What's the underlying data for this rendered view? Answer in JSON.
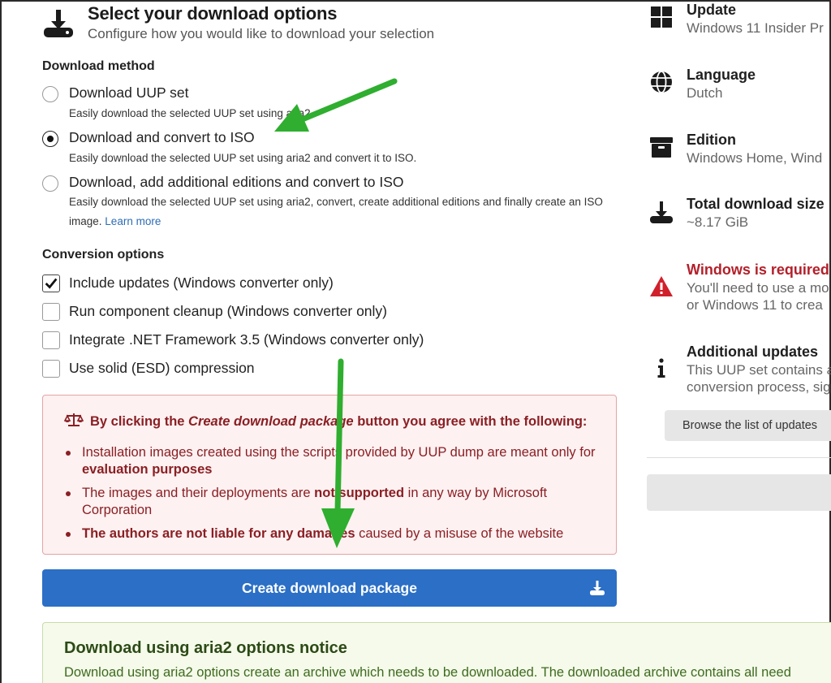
{
  "header": {
    "title": "Select your download options",
    "subtitle": "Configure how you would like to download your selection"
  },
  "download_method": {
    "label": "Download method",
    "options": [
      {
        "label": "Download UUP set",
        "desc": "Easily download the selected UUP set using aria2.",
        "checked": false
      },
      {
        "label": "Download and convert to ISO",
        "desc": "Easily download the selected UUP set using aria2 and convert it to ISO.",
        "checked": true
      },
      {
        "label": "Download, add additional editions and convert to ISO",
        "desc": "Easily download the selected UUP set using aria2, convert, create additional editions and finally create an ISO image.",
        "link": "Learn more",
        "checked": false
      }
    ]
  },
  "conversion": {
    "label": "Conversion options",
    "options": [
      {
        "label": "Include updates (Windows converter only)",
        "checked": true
      },
      {
        "label": "Run component cleanup (Windows converter only)",
        "checked": false
      },
      {
        "label": "Integrate .NET Framework 3.5 (Windows converter only)",
        "checked": false
      },
      {
        "label": "Use solid (ESD) compression",
        "checked": false
      }
    ]
  },
  "agreement": {
    "head_pre": "By clicking the ",
    "head_em": "Create download package",
    "head_post": " button you agree with the following:",
    "items": [
      {
        "pre": "Installation images created using the scripts provided by UUP dump are meant only for ",
        "bold": "evaluation purposes",
        "post": ""
      },
      {
        "pre": "The images and their deployments are ",
        "bold": "not supported",
        "post": " in any way by Microsoft Corporation"
      },
      {
        "pre": "",
        "bold": "The authors are not liable for any damages",
        "post": " caused by a misuse of the website"
      }
    ]
  },
  "create_button": "Create download package",
  "aria_notice": {
    "title": "Download using aria2 options notice",
    "text": "Download using aria2 options create an archive which needs to be downloaded. The downloaded archive contains all need"
  },
  "sidebar": {
    "update": {
      "title": "Update",
      "value": "Windows 11 Insider Pr"
    },
    "language": {
      "title": "Language",
      "value": "Dutch"
    },
    "edition": {
      "title": "Edition",
      "value": "Windows Home, Wind"
    },
    "size": {
      "title": "Total download size",
      "value": "~8.17 GiB"
    },
    "windows_required": {
      "title": "Windows is required",
      "line1": "You'll need to use a mo",
      "line2": "or Windows 11 to crea"
    },
    "additional": {
      "title": "Additional updates",
      "line1": "This UUP set contains a",
      "line2": "conversion process, sig"
    },
    "browse_button": "Browse the list of updates"
  },
  "colors": {
    "primary": "#2b6fc6",
    "danger": "#b3202a",
    "agreement_text": "#8a1f24",
    "arrow": "#2fae2f"
  }
}
